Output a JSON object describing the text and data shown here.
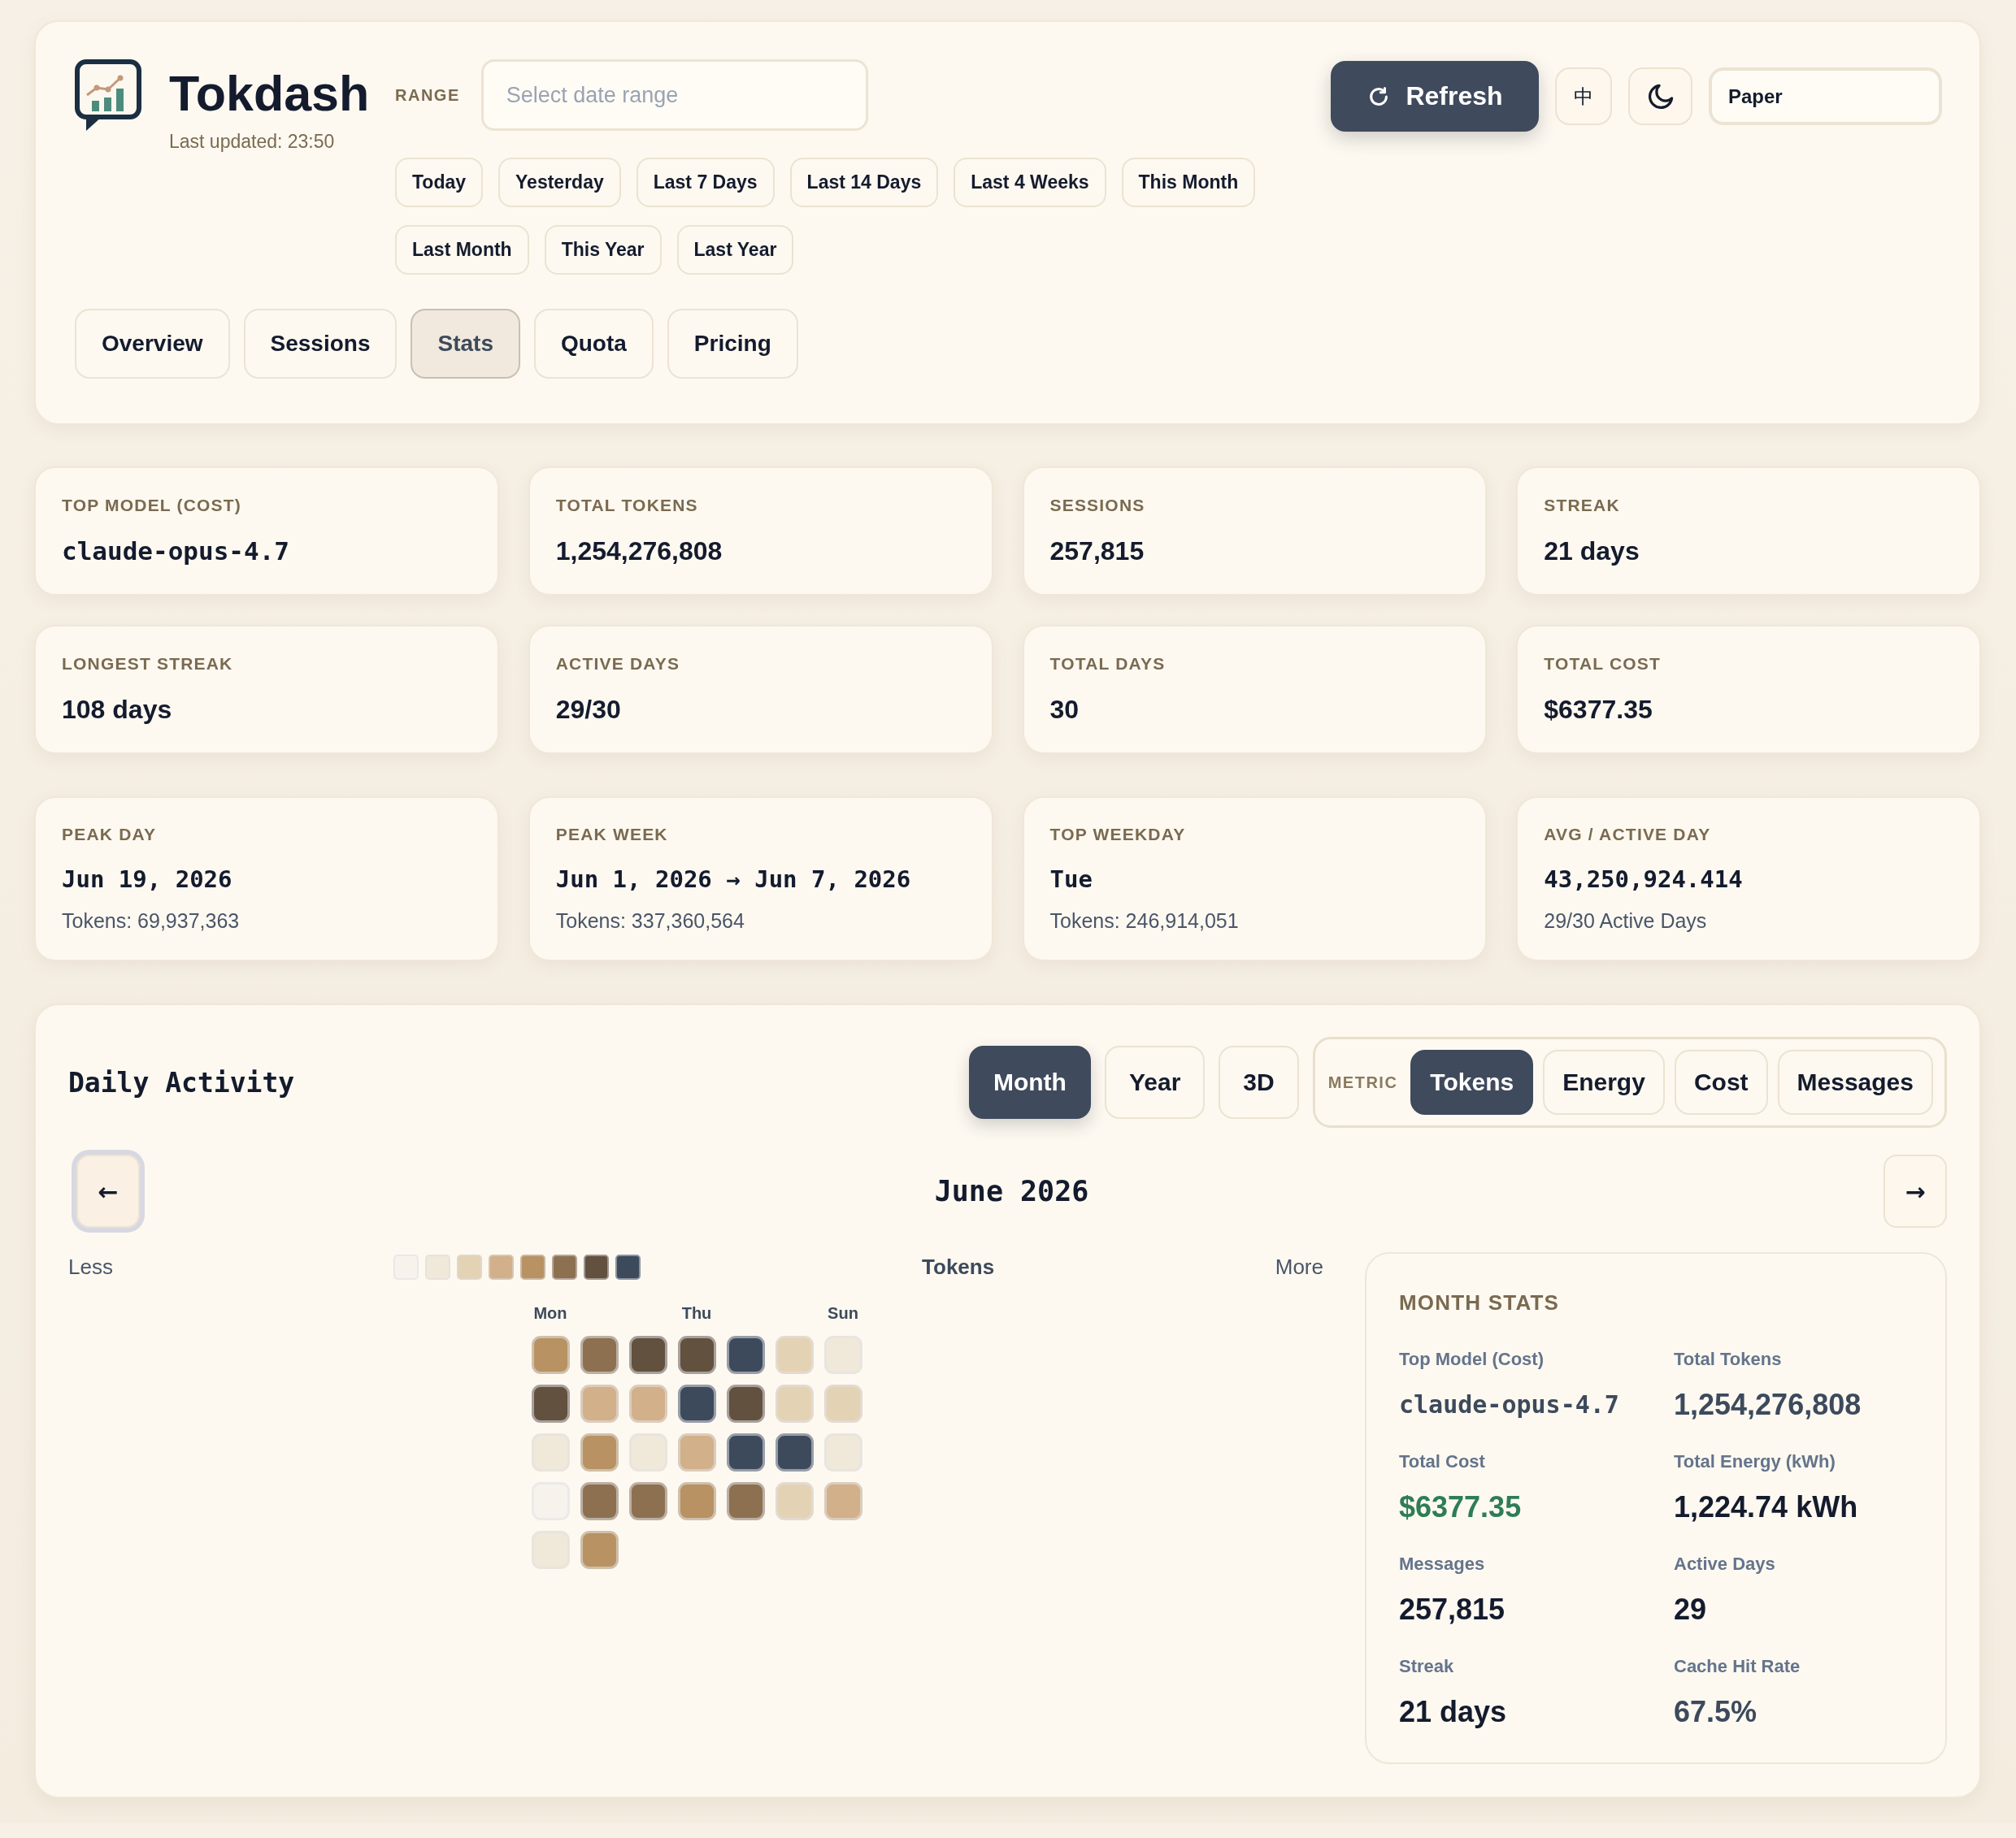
{
  "header": {
    "app_name": "Tokdash",
    "last_updated": "Last updated: 23:50",
    "range_label": "RANGE",
    "date_range": {
      "placeholder": "Select date range"
    },
    "presets": [
      "Today",
      "Yesterday",
      "Last 7 Days",
      "Last 14 Days",
      "Last 4 Weeks",
      "This Month",
      "Last Month",
      "This Year",
      "Last Year"
    ],
    "refresh_button": "Refresh",
    "language_button": "中",
    "theme_select": {
      "value": "Paper"
    }
  },
  "tabs": [
    {
      "label": "Overview",
      "selected": false
    },
    {
      "label": "Sessions",
      "selected": false
    },
    {
      "label": "Stats",
      "selected": true
    },
    {
      "label": "Quota",
      "selected": false
    },
    {
      "label": "Pricing",
      "selected": false
    }
  ],
  "stats": [
    {
      "label": "TOP MODEL (COST)",
      "value": "claude-opus-4.7",
      "kind": "code"
    },
    {
      "label": "TOTAL TOKENS",
      "value": "1,254,276,808",
      "kind": "plain"
    },
    {
      "label": "SESSIONS",
      "value": "257,815",
      "kind": "plain"
    },
    {
      "label": "STREAK",
      "value": "21 days",
      "kind": "plain"
    },
    {
      "label": "LONGEST STREAK",
      "value": "108 days",
      "kind": "plain"
    },
    {
      "label": "ACTIVE DAYS",
      "value": "29/30",
      "kind": "plain"
    },
    {
      "label": "TOTAL DAYS",
      "value": "30",
      "kind": "plain"
    },
    {
      "label": "TOTAL COST",
      "value": "$6377.35",
      "kind": "plain"
    }
  ],
  "highlights": [
    {
      "label": "PEAK DAY",
      "value": "Jun 19, 2026",
      "sub": "Tokens: 69,937,363"
    },
    {
      "label": "PEAK WEEK",
      "value": "Jun 1, 2026 → Jun 7, 2026",
      "sub": "Tokens: 337,360,564"
    },
    {
      "label": "TOP WEEKDAY",
      "value": "Tue",
      "sub": "Tokens: 246,914,051"
    },
    {
      "label": "AVG / ACTIVE DAY",
      "value": "43,250,924.414",
      "sub": "29/30 Active Days"
    }
  ],
  "daily_activity": {
    "title": "Daily Activity",
    "views": [
      {
        "label": "Month",
        "selected": true
      },
      {
        "label": "Year",
        "selected": false
      },
      {
        "label": "3D",
        "selected": false
      }
    ],
    "metric_label": "METRIC",
    "metrics": [
      {
        "label": "Tokens",
        "selected": true
      },
      {
        "label": "Energy",
        "selected": false
      },
      {
        "label": "Cost",
        "selected": false
      },
      {
        "label": "Messages",
        "selected": false
      }
    ],
    "prev_button": {
      "label": "←",
      "focused": true
    },
    "month_title": "June 2026",
    "next_button": {
      "label": "→",
      "focused": false
    },
    "legend": {
      "less": "Less",
      "swatches": [
        {
          "color": "#f7f3ec"
        },
        {
          "color": "#f0e8d8"
        },
        {
          "color": "#e4d2b4"
        },
        {
          "color": "#d2b08a"
        },
        {
          "color": "#b89262"
        },
        {
          "color": "#8d7050"
        },
        {
          "color": "#62513f"
        },
        {
          "color": "#3d4a5c"
        }
      ],
      "metric": "Tokens",
      "more": "More"
    },
    "weekday_labels": [
      "Mon",
      "Thu",
      "Sun"
    ],
    "days": [
      {
        "color": "#b89262"
      },
      {
        "color": "#8d7050"
      },
      {
        "color": "#62513f"
      },
      {
        "color": "#62513f"
      },
      {
        "color": "#3d4a5c"
      },
      {
        "color": "#e4d2b4"
      },
      {
        "color": "#f0e8d8"
      },
      {
        "color": "#62513f"
      },
      {
        "color": "#d2b08a"
      },
      {
        "color": "#d2b08a"
      },
      {
        "color": "#3d4a5c"
      },
      {
        "color": "#62513f"
      },
      {
        "color": "#e4d2b4"
      },
      {
        "color": "#e4d2b4"
      },
      {
        "color": "#f0e8d8"
      },
      {
        "color": "#b89262"
      },
      {
        "color": "#f0e8d8"
      },
      {
        "color": "#d2b08a"
      },
      {
        "color": "#3d4a5c"
      },
      {
        "color": "#3d4a5c"
      },
      {
        "color": "#f0e8d8"
      },
      {
        "color": "#f7f3ec"
      },
      {
        "color": "#8d7050"
      },
      {
        "color": "#8d7050"
      },
      {
        "color": "#b89262"
      },
      {
        "color": "#8d7050"
      },
      {
        "color": "#e4d2b4"
      },
      {
        "color": "#d2b08a"
      },
      {
        "color": "#f0e8d8"
      },
      {
        "color": "#b89262"
      }
    ]
  },
  "month_stats": {
    "title": "MONTH STATS",
    "items": [
      {
        "label": "Top Model (Cost)",
        "value": "claude-opus-4.7",
        "kind": "code"
      },
      {
        "label": "Total Tokens",
        "value": "1,254,276,808",
        "kind": "muted"
      },
      {
        "label": "Total Cost",
        "value": "$6377.35",
        "kind": "money"
      },
      {
        "label": "Total Energy (kWh)",
        "value": "1,224.74 kWh",
        "kind": "plain"
      },
      {
        "label": "Messages",
        "value": "257,815",
        "kind": "plain"
      },
      {
        "label": "Active Days",
        "value": "29",
        "kind": "plain"
      },
      {
        "label": "Streak",
        "value": "21 days",
        "kind": "plain"
      },
      {
        "label": "Cache Hit Rate",
        "value": "67.5%",
        "kind": "muted"
      }
    ]
  }
}
